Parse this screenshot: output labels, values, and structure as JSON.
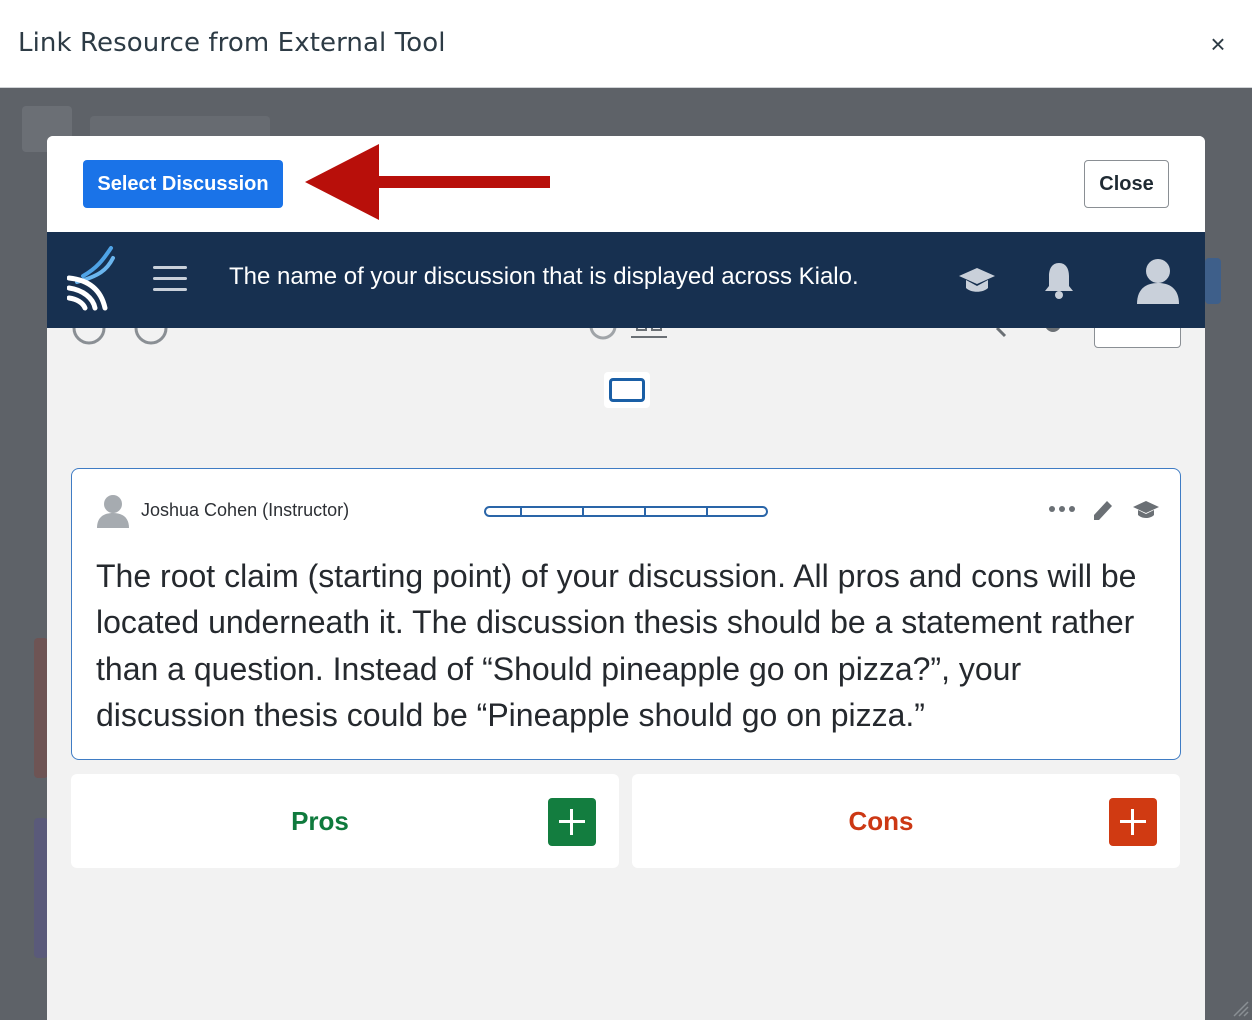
{
  "dialog": {
    "title": "Link Resource from External Tool",
    "close_glyph": "×"
  },
  "kialo_modal": {
    "select_button": "Select Discussion",
    "close_button": "Close",
    "annotation_arrow_color": "#b80f0a"
  },
  "navbar": {
    "title": "The name of your discussion that is displayed across Kialo.",
    "background": "#173050",
    "icons": [
      "kialo-logo-icon",
      "menu-icon",
      "graduation-cap-icon",
      "bell-icon",
      "user-avatar-icon"
    ]
  },
  "claim": {
    "author": "Joshua Cohen (Instructor)",
    "text": "The root claim (starting point) of your discussion. All pros and cons will be located underneath it. The discussion thesis should be a statement rather than a question. Instead of “Should pineapple go on pizza?”, your discussion thesis could be “Pineapple should go on pizza.”",
    "border_color": "#3f7cc4"
  },
  "columns": {
    "pros": {
      "label": "Pros",
      "color": "#0f7a3d"
    },
    "cons": {
      "label": "Cons",
      "color": "#cc3814"
    }
  },
  "colors": {
    "primary_button": "#1a73e8",
    "backdrop": "#5e6268"
  }
}
